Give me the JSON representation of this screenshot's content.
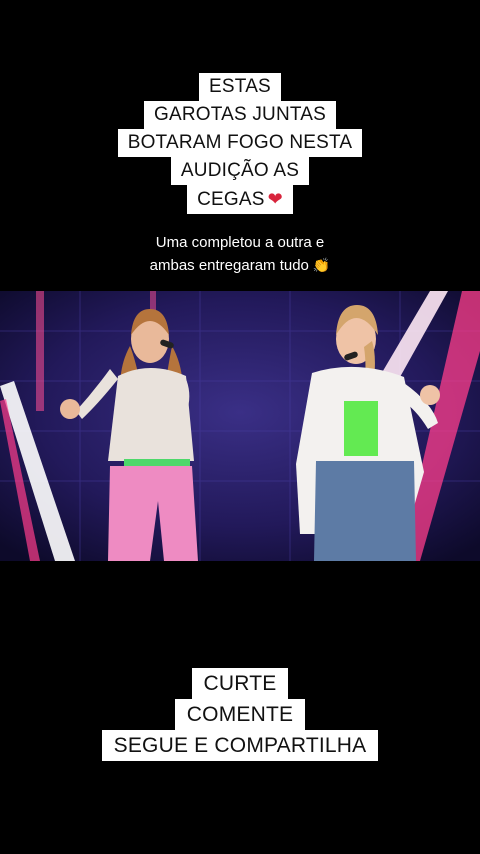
{
  "top_caption": {
    "lines": [
      "ESTAS",
      "GAROTAS JUNTAS",
      "BOTARAM FOGO NESTA",
      "AUDIÇÃO AS",
      "CEGAS"
    ],
    "emoji": "heart-on-fire"
  },
  "subtitle": {
    "line1": "Uma completou a outra e",
    "line2": "ambas entregaram tudo",
    "emoji": "clapping-hands"
  },
  "bottom_caption": {
    "lines": [
      "CURTE",
      "COMENTE",
      "SEGUE E COMPARTILHA"
    ]
  },
  "colors": {
    "background": "#000000",
    "caption_bg": "#ffffff",
    "caption_text": "#111111",
    "stage_purple": "#2a1f63",
    "neon_pink": "#ff3d8b"
  }
}
